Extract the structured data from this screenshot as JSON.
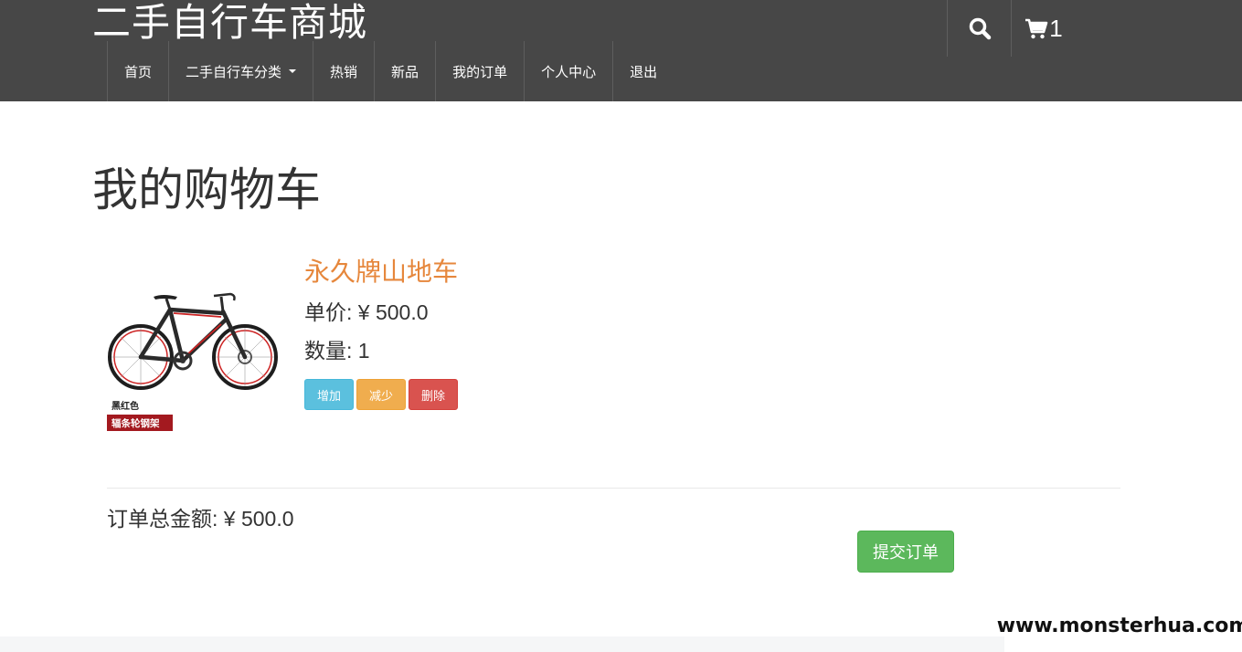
{
  "brand": "二手自行车商城",
  "nav": {
    "items": [
      {
        "label": "首页"
      },
      {
        "label": "二手自行车分类"
      },
      {
        "label": "热销"
      },
      {
        "label": "新品"
      },
      {
        "label": "我的订单"
      },
      {
        "label": "个人中心"
      },
      {
        "label": "退出"
      }
    ]
  },
  "header_tools": {
    "cart_count": "1"
  },
  "page": {
    "title": "我的购物车"
  },
  "cart": {
    "item": {
      "name": "永久牌山地车",
      "price_line": "单价: ¥ 500.0",
      "qty_line": "数量: 1",
      "image_text_color": "黑红色",
      "image_text_tag": "辐条轮钢架",
      "buttons": {
        "add": "增加",
        "reduce": "减少",
        "delete": "删除"
      }
    },
    "total_line": "订单总金额: ¥ 500.0",
    "submit": "提交订单"
  },
  "watermark": "www.monsterhua.com",
  "colors": {
    "header_bg": "#474747",
    "product_name": "#e6873c",
    "info_btn": "#5bc0de",
    "warning_btn": "#f0ad4e",
    "danger_btn": "#d9534f",
    "success_btn": "#5cb85c"
  }
}
